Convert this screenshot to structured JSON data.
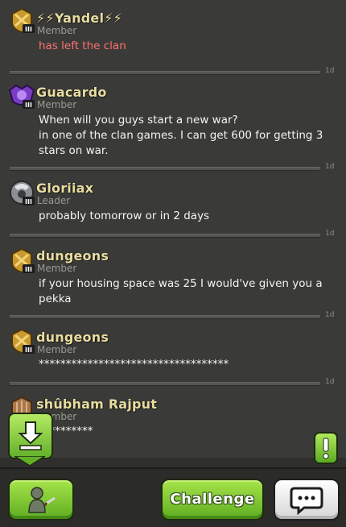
{
  "messages": [
    {
      "name": "⚡⚡Yandel⚡⚡",
      "role": "Member",
      "text": "has left the clan",
      "age": "1d",
      "badge": "gold-clan-badge-icon",
      "event": true
    },
    {
      "name": "Guacardo",
      "role": "Member",
      "text": "When will you guys start a new war?\nin one of the clan games. I can get 600 for getting 3 stars on war.",
      "age": "1d",
      "badge": "purple-clan-badge-icon"
    },
    {
      "name": "Gloriiax",
      "role": "Leader",
      "text": "probably tomorrow or in 2 days",
      "age": "1d",
      "badge": "silver-clan-badge-icon"
    },
    {
      "name": "dungeons",
      "role": "Member",
      "text": "if your housing space was 25 I would've given you a pekka",
      "age": "1d",
      "badge": "gold-clan-badge-icon"
    },
    {
      "name": "dungeons",
      "role": "Member",
      "text": "***********************************",
      "age": "1d",
      "badge": "gold-clan-badge-icon"
    },
    {
      "name": "shûbham Rajput",
      "role": "Member",
      "text": "**********",
      "age": "",
      "badge": "bronze-clan-badge-icon"
    }
  ],
  "badge_level": "III",
  "toolbar": {
    "challenge_label": "Challenge",
    "troops_icon": "barbarian-icon",
    "chat_icon": "speech-bubble-icon",
    "download_icon": "download-arrow-icon",
    "alert_icon": "exclamation-icon"
  },
  "colors": {
    "background": "#3a3b38",
    "name": "#e8dca0",
    "event_text": "#ff7070",
    "button_green": "#7cc835"
  }
}
